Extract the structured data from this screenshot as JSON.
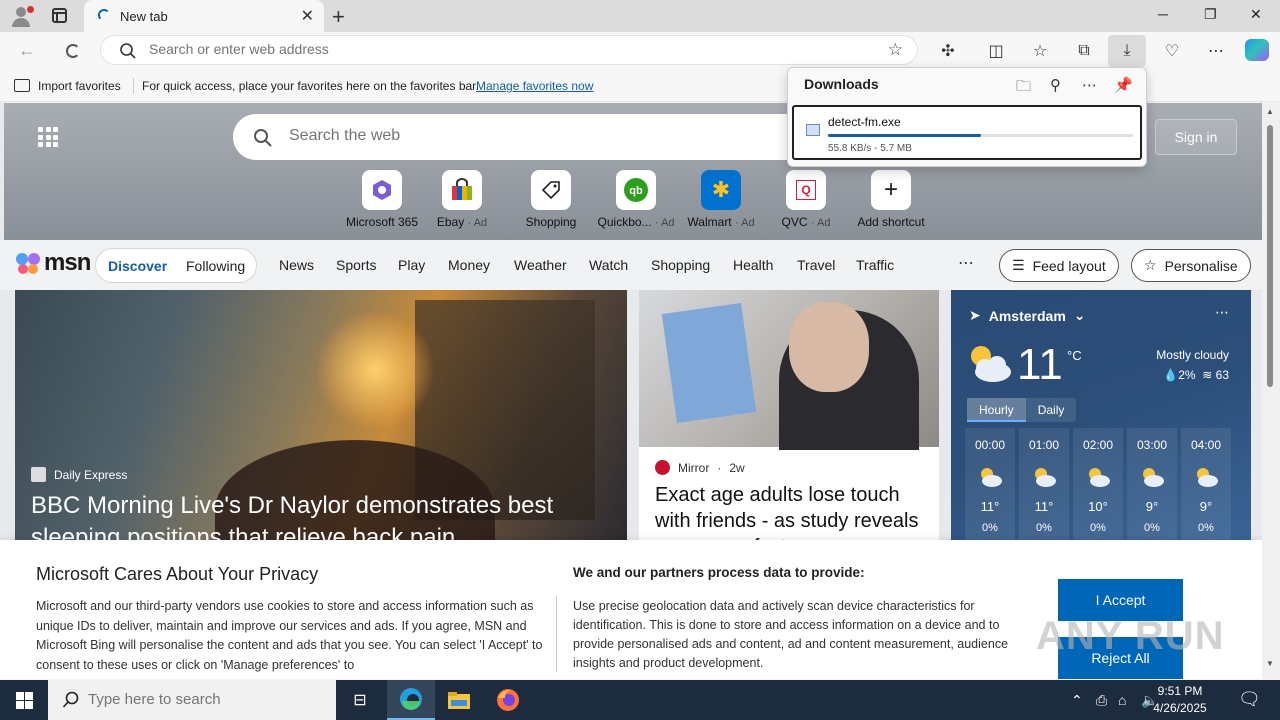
{
  "browser": {
    "tab_title": "New tab",
    "address_placeholder": "Search or enter web address"
  },
  "favbar": {
    "import_label": "Import favorites",
    "message": "For quick access, place your favorites here on the favorites bar.",
    "manage_link": "Manage favorites now"
  },
  "downloads": {
    "title": "Downloads",
    "file_name": "detect-fm.exe",
    "status": "55.8 KB/s - 5.7 MB",
    "progress": 0.5
  },
  "hero": {
    "search_placeholder": "Search the web",
    "signin_label": "Sign in",
    "shortcuts": [
      {
        "label": "Microsoft 365",
        "ad": ""
      },
      {
        "label": "Ebay",
        "ad": "· Ad"
      },
      {
        "label": "Shopping",
        "ad": ""
      },
      {
        "label": "Quickbo...",
        "ad": "· Ad"
      },
      {
        "label": "Walmart",
        "ad": "· Ad"
      },
      {
        "label": "QVC",
        "ad": "· Ad"
      },
      {
        "label": "Add shortcut",
        "ad": ""
      }
    ]
  },
  "msn": {
    "logo": "msn",
    "discover": "Discover",
    "following": "Following",
    "links": [
      "News",
      "Sports",
      "Play",
      "Money",
      "Weather",
      "Watch",
      "Shopping",
      "Health",
      "Travel",
      "Traffic"
    ],
    "feed_layout": "Feed layout",
    "personalise": "Personalise"
  },
  "cards": {
    "main": {
      "source": "Daily Express",
      "headline": "BBC Morning Live's Dr Naylor demonstrates best sleeping positions that relieve back pain"
    },
    "second": {
      "source": "Mirror",
      "age": "2w",
      "headline": "Exact age adults lose touch with friends - as study reveals a common factor"
    }
  },
  "weather": {
    "location": "Amsterdam",
    "temp": "11",
    "unit": "°C",
    "condition": "Mostly cloudy",
    "precip": "2%",
    "aqi": "63",
    "tab_hourly": "Hourly",
    "tab_daily": "Daily",
    "hours": [
      {
        "time": "00:00",
        "temp": "11°",
        "precip": "0%"
      },
      {
        "time": "01:00",
        "temp": "11°",
        "precip": "0%"
      },
      {
        "time": "02:00",
        "temp": "10°",
        "precip": "0%"
      },
      {
        "time": "03:00",
        "temp": "9°",
        "precip": "0%"
      },
      {
        "time": "04:00",
        "temp": "9°",
        "precip": "0%"
      }
    ]
  },
  "privacy": {
    "title": "Microsoft Cares About Your Privacy",
    "body": "Microsoft and our third-party vendors use cookies to store and access information such as unique IDs to deliver, maintain and improve our services and ads. If you agree, MSN and Microsoft Bing will personalise the content and ads that you see. You can select 'I Accept' to consent to these uses or click on 'Manage preferences' to",
    "partners_title": "We and our partners process data to provide:",
    "partners_body": "Use precise geolocation data and actively scan device characteristics for identification. This is done to store and access information on a device and to provide personalised ads and content, ad and content measurement, audience insights and product development.",
    "accept": "I Accept",
    "reject": "Reject All"
  },
  "watermark": "ANY RUN",
  "taskbar": {
    "search_placeholder": "Type here to search",
    "time": "9:51 PM",
    "date": "4/26/2025"
  }
}
